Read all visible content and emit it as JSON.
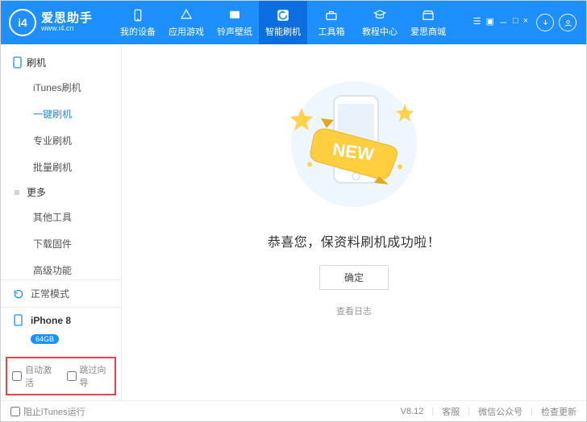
{
  "brand": {
    "name": "爱思助手",
    "url": "www.i4.cn",
    "logo_text": "i4"
  },
  "nav": [
    {
      "label": "我的设备",
      "icon": "device"
    },
    {
      "label": "应用游戏",
      "icon": "apps"
    },
    {
      "label": "铃声壁纸",
      "icon": "media"
    },
    {
      "label": "智能刷机",
      "icon": "flash",
      "active": true
    },
    {
      "label": "工具箱",
      "icon": "toolbox"
    },
    {
      "label": "教程中心",
      "icon": "tutorial"
    },
    {
      "label": "爱思商城",
      "icon": "store"
    }
  ],
  "sidebar": {
    "group1": {
      "title": "刷机",
      "items": [
        "iTunes刷机",
        "一键刷机",
        "专业刷机",
        "批量刷机"
      ],
      "activeIndex": 1
    },
    "group2": {
      "title": "更多",
      "items": [
        "其他工具",
        "下载固件",
        "高级功能"
      ]
    },
    "mode": "正常模式",
    "device": {
      "name": "iPhone 8",
      "storage": "64GB"
    },
    "options": {
      "autoActivate": "自动激活",
      "skipGuide": "跳过向导"
    }
  },
  "main": {
    "message": "恭喜您，保资料刷机成功啦！",
    "ok": "确定",
    "viewLog": "查看日志",
    "newBadge": "NEW"
  },
  "footer": {
    "blockItunes": "阻止iTunes运行",
    "version": "V8.12",
    "support": "客服",
    "wechat": "微信公众号",
    "checkUpdate": "检查更新"
  }
}
